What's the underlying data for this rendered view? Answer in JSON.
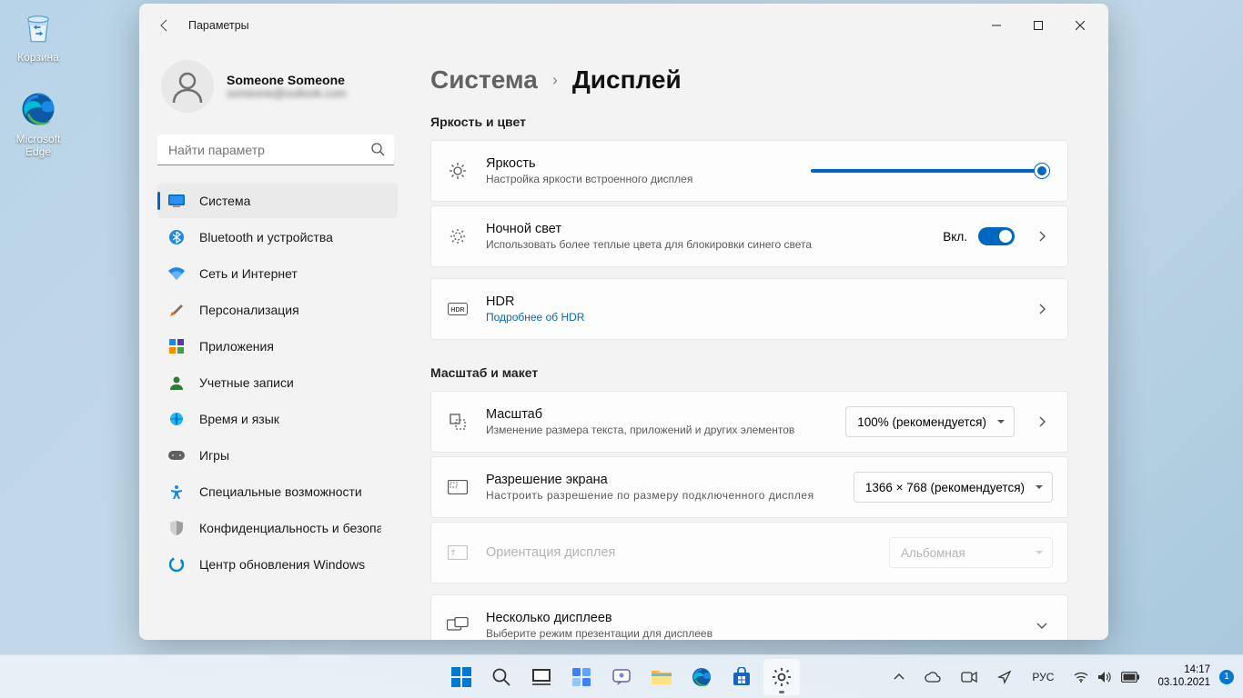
{
  "desktop": {
    "recycle": "Корзина",
    "edge": "Microsoft Edge"
  },
  "window": {
    "app_title": "Параметры",
    "profile": {
      "name": "Someone Someone",
      "email": "someone@outlook.com"
    },
    "search_placeholder": "Найти параметр",
    "nav": [
      {
        "label": "Система"
      },
      {
        "label": "Bluetooth и устройства"
      },
      {
        "label": "Сеть и Интернет"
      },
      {
        "label": "Персонализация"
      },
      {
        "label": "Приложения"
      },
      {
        "label": "Учетные записи"
      },
      {
        "label": "Время и язык"
      },
      {
        "label": "Игры"
      },
      {
        "label": "Специальные возможности"
      },
      {
        "label": "Конфиденциальность и безопасность"
      },
      {
        "label": "Центр обновления Windows"
      }
    ],
    "breadcrumb": {
      "parent": "Система",
      "current": "Дисплей"
    },
    "sections": {
      "brightness_color": "Яркость и цвет",
      "scale_layout": "Масштаб и макет"
    },
    "rows": {
      "brightness": {
        "title": "Яркость",
        "sub": "Настройка яркости встроенного дисплея",
        "value": 100
      },
      "nightlight": {
        "title": "Ночной свет",
        "sub": "Использовать более теплые цвета для блокировки синего света",
        "state_label": "Вкл.",
        "on": true
      },
      "hdr": {
        "title": "HDR",
        "link": "Подробнее об HDR"
      },
      "scale": {
        "title": "Масштаб",
        "sub": "Изменение размера текста, приложений и других элементов",
        "value": "100% (рекомендуется)"
      },
      "resolution": {
        "title": "Разрешение экрана",
        "sub": "Настроить разрешение по размеру подключенного дисплея",
        "value": "1366 × 768 (рекомендуется)"
      },
      "orientation": {
        "title": "Ориентация дисплея",
        "value": "Альбомная"
      },
      "multiple": {
        "title": "Несколько дисплеев",
        "sub": "Выберите режим презентации для дисплеев"
      }
    }
  },
  "taskbar": {
    "lang": "РУС",
    "time": "14:17",
    "date": "03.10.2021",
    "notif_count": "1"
  }
}
